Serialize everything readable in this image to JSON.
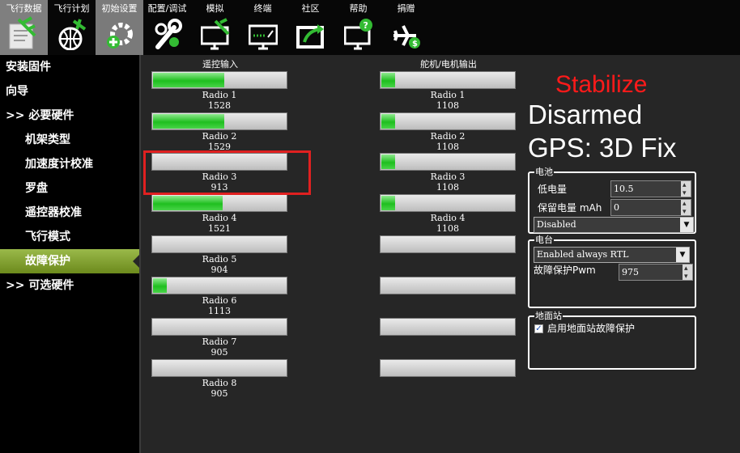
{
  "toolbar": {
    "items": [
      {
        "label": "飞行数据",
        "icon": "flight-data-icon"
      },
      {
        "label": "飞行计划",
        "icon": "flight-plan-globe-icon"
      },
      {
        "label": "初始设置",
        "icon": "initial-setup-gear-icon"
      },
      {
        "label": "配置/调试",
        "icon": "config-tuning-wrench-icon"
      },
      {
        "label": "模拟",
        "icon": "simulation-monitor-icon"
      },
      {
        "label": "终端",
        "icon": "terminal-monitor-icon"
      },
      {
        "label": "社区",
        "icon": "community-share-icon"
      },
      {
        "label": "帮助",
        "icon": "help-monitor-icon"
      },
      {
        "label": "捐赠",
        "icon": "donate-plane-icon"
      }
    ]
  },
  "sidebar": {
    "items": [
      {
        "label": "安装固件"
      },
      {
        "label": "向导"
      },
      {
        "label": ">> 必要硬件"
      },
      {
        "label": "机架类型"
      },
      {
        "label": "加速度计校准"
      },
      {
        "label": "罗盘"
      },
      {
        "label": "遥控器校准"
      },
      {
        "label": "飞行模式"
      },
      {
        "label": "故障保护"
      },
      {
        "label": ">> 可选硬件"
      }
    ]
  },
  "radio_in": {
    "title": "遥控输入",
    "channels": [
      {
        "name": "Radio 1",
        "value": "1528",
        "fill": 0.53
      },
      {
        "name": "Radio 2",
        "value": "1529",
        "fill": 0.53
      },
      {
        "name": "Radio 3",
        "value": "913",
        "fill": 0.0
      },
      {
        "name": "Radio 4",
        "value": "1521",
        "fill": 0.52
      },
      {
        "name": "Radio 5",
        "value": "904",
        "fill": 0.0
      },
      {
        "name": "Radio 6",
        "value": "1113",
        "fill": 0.1
      },
      {
        "name": "Radio 7",
        "value": "905",
        "fill": 0.0
      },
      {
        "name": "Radio 8",
        "value": "905",
        "fill": 0.0
      }
    ]
  },
  "servo_out": {
    "title": "舵机/电机输出",
    "channels": [
      {
        "name": "Radio 1",
        "value": "1108",
        "fill": 0.1
      },
      {
        "name": "Radio 2",
        "value": "1108",
        "fill": 0.1
      },
      {
        "name": "Radio 3",
        "value": "1108",
        "fill": 0.1
      },
      {
        "name": "Radio 4",
        "value": "1108",
        "fill": 0.1
      },
      {
        "name": "",
        "value": "",
        "fill": 0.0
      },
      {
        "name": "",
        "value": "",
        "fill": 0.0
      },
      {
        "name": "",
        "value": "",
        "fill": 0.0
      },
      {
        "name": "",
        "value": "",
        "fill": 0.0
      }
    ]
  },
  "status": {
    "mode": "Stabilize",
    "armed": "Disarmed",
    "gps": "GPS: 3D Fix"
  },
  "battery": {
    "title": "电池",
    "low_label": "低电量",
    "low_value": "10.5",
    "reserve_label": "保留电量 mAh",
    "reserve_value": "0",
    "action": "Disabled"
  },
  "radio_group": {
    "title": "电台",
    "action": "Enabled always RTL",
    "pwm_label": "故障保护Pwm",
    "pwm_value": "975"
  },
  "gcs": {
    "title": "地面站",
    "checkbox_label": "启用地面站故障保护",
    "checked": true
  },
  "colors": {
    "mode": "#ff1a1a",
    "bar_fill": "#1fbf1f",
    "selected_menu": "#8aab3a",
    "highlight": "#e02020"
  }
}
